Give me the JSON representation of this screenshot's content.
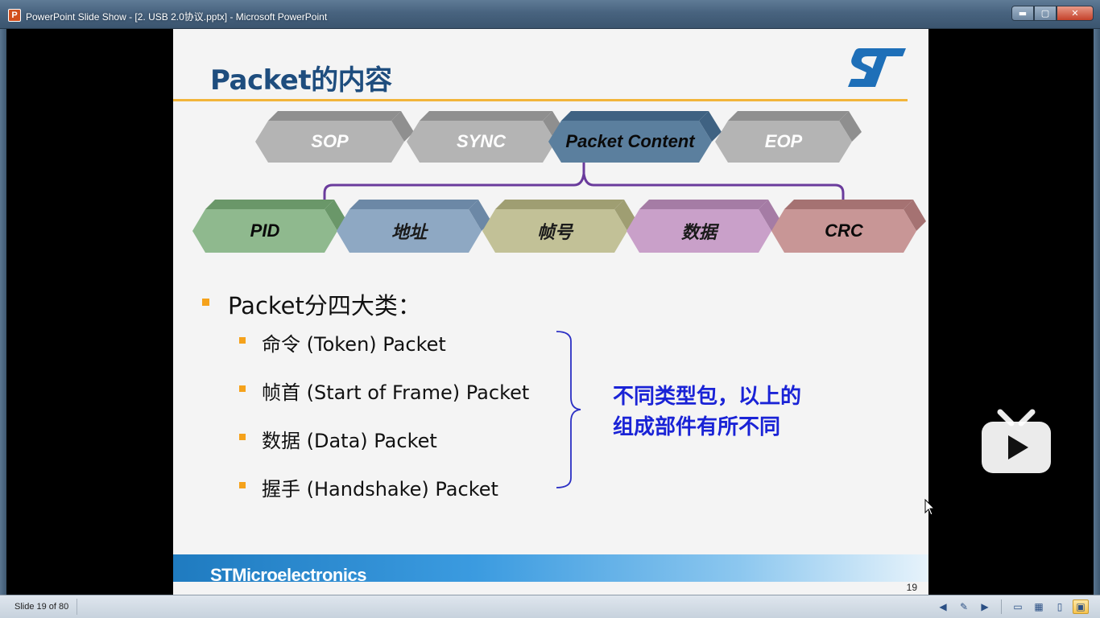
{
  "window": {
    "icon_letter": "P",
    "title": "PowerPoint Slide Show - [2. USB 2.0协议.pptx] - Microsoft PowerPoint",
    "minimize_glyph": "▬",
    "maximize_glyph": "▢",
    "close_glyph": "✕"
  },
  "slide": {
    "title": "Packet的内容",
    "logo_text": "ST",
    "top_row": [
      {
        "label": "SOP",
        "color": "#b4b4b4",
        "dark": "#8f8f8f",
        "text_color": "#ffffff"
      },
      {
        "label": "SYNC",
        "color": "#b4b4b4",
        "dark": "#8f8f8f",
        "text_color": "#ffffff"
      },
      {
        "label": "Packet  Content",
        "color": "#5b7f9e",
        "dark": "#3f6282",
        "text_color": "#0a0a0a"
      },
      {
        "label": "EOP",
        "color": "#b4b4b4",
        "dark": "#8f8f8f",
        "text_color": "#ffffff"
      }
    ],
    "bottom_row": [
      {
        "label": "PID",
        "color": "#8fb98e",
        "dark": "#6a9769",
        "text_color": "#0a0a0a"
      },
      {
        "label": "地址",
        "color": "#8ea8c3",
        "dark": "#6c88a6",
        "text_color": "#1a1a1a"
      },
      {
        "label": "帧号",
        "color": "#c2c197",
        "dark": "#9f9e72",
        "text_color": "#1a1a1a"
      },
      {
        "label": "数据",
        "color": "#c9a0c9",
        "dark": "#a57ca5",
        "text_color": "#1a1a1a"
      },
      {
        "label": "CRC",
        "color": "#c89696",
        "dark": "#a57272",
        "text_color": "#0a0a0a"
      }
    ],
    "bullets": {
      "main": "Packet分四大类：",
      "items": [
        "命令 (Token) Packet",
        "帧首 (Start of Frame) Packet",
        "数据 (Data) Packet",
        "握手 (Handshake) Packet"
      ]
    },
    "note_lines": [
      "不同类型包，以上的",
      "组成部件有所不同"
    ],
    "footer_brand": "STMicroelectronics",
    "page_number": "19",
    "colors": {
      "title": "#1e4d7e",
      "rule": "#f2b53a",
      "bracket": "#6a3b9c",
      "note": "#1a23d6",
      "bullet": "#f5a21b"
    }
  },
  "statusbar": {
    "slide_counter": "Slide 19 of 80",
    "icons": [
      "previous-icon",
      "notes-icon",
      "next-icon",
      "normal-view-icon",
      "slide-sorter-icon",
      "reading-view-icon",
      "slide-show-icon"
    ]
  }
}
